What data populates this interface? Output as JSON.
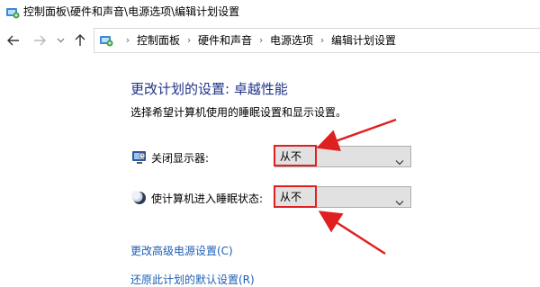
{
  "window": {
    "title": "控制面板\\硬件和声音\\电源选项\\编辑计划设置",
    "icon": "control-panel-icon"
  },
  "nav": {
    "back_icon": "arrow-left-icon",
    "forward_icon": "arrow-right-icon",
    "recent_icon": "chevron-down-icon",
    "up_icon": "arrow-up-icon"
  },
  "breadcrumb": {
    "icon": "control-panel-icon",
    "items": [
      {
        "label": "控制面板"
      },
      {
        "label": "硬件和声音"
      },
      {
        "label": "电源选项"
      },
      {
        "label": "编辑计划设置"
      }
    ]
  },
  "main": {
    "heading": "更改计划的设置: 卓越性能",
    "subtitle": "选择希望计算机使用的睡眠设置和显示设置。",
    "settings": [
      {
        "label": "关闭显示器:",
        "icon": "monitor-icon",
        "value": "从不"
      },
      {
        "label": "使计算机进入睡眠状态:",
        "icon": "moon-icon",
        "value": "从不"
      }
    ],
    "links": [
      {
        "label": "更改高级电源设置(C)"
      },
      {
        "label": "还原此计划的默认设置(R)"
      }
    ]
  },
  "colors": {
    "heading": "#1e3287",
    "link": "#1e5fb4",
    "annotation": "#e02020"
  }
}
